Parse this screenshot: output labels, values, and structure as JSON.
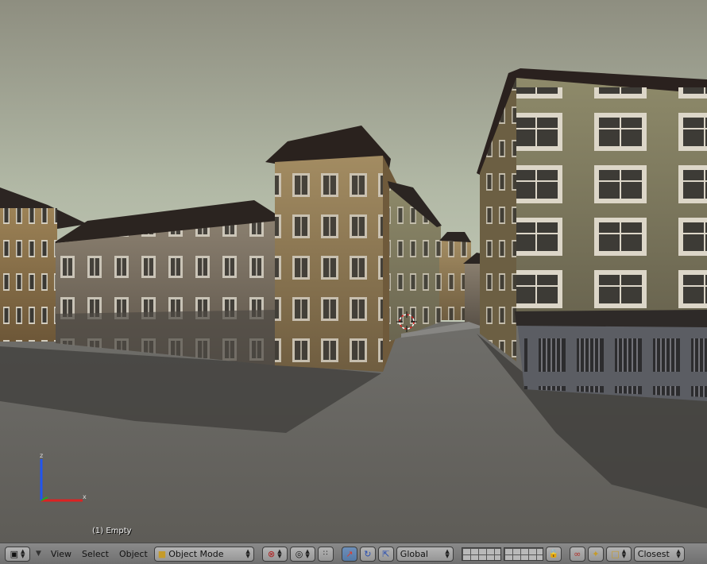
{
  "viewport": {
    "object_label": "(1) Empty",
    "axes": {
      "x": "x",
      "z": "z"
    }
  },
  "header": {
    "editor_type_icon": "cube-icon",
    "menus": [
      "View",
      "Select",
      "Object"
    ],
    "mode": {
      "label": "Object Mode",
      "icon": "cube-mode-icon"
    },
    "pivot_icon": "pivot-point-icon",
    "manipulator_icons": [
      "translate-icon",
      "rotate-icon",
      "scale-icon"
    ],
    "orientation": "Global",
    "snap_target": "Closest",
    "colors": {
      "header_bg": "#7c7c7c",
      "active_button": "#5f83b0"
    }
  }
}
